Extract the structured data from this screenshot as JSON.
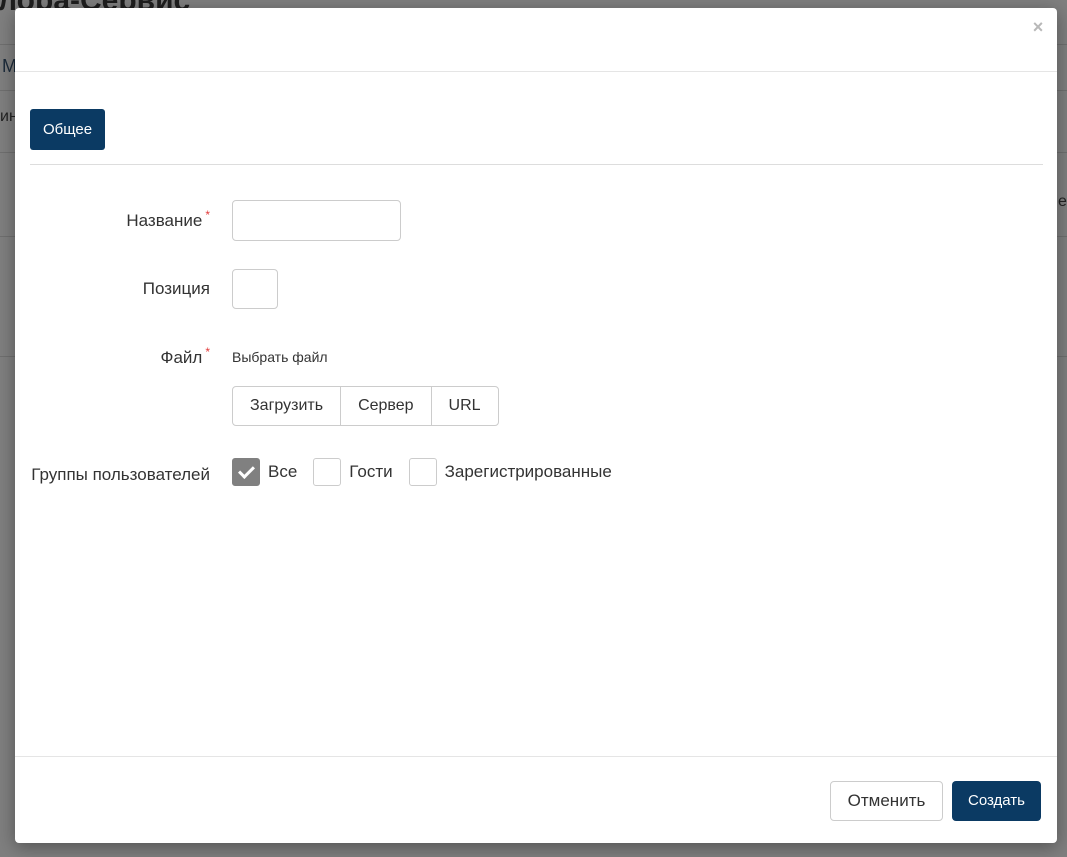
{
  "background": {
    "title": "лора-Сервис",
    "fragment_1": "М",
    "fragment_2": "ин",
    "fragment_3": "е"
  },
  "modal": {
    "close_icon": "close-icon",
    "tabs": [
      {
        "label": "Общее",
        "active": true
      }
    ],
    "form": {
      "name": {
        "label": "Название",
        "required_mark": "*",
        "value": ""
      },
      "position": {
        "label": "Позиция",
        "value": ""
      },
      "file": {
        "label": "Файл",
        "required_mark": "*",
        "title": "Выбрать файл",
        "sources": [
          "Загрузить",
          "Сервер",
          "URL"
        ]
      },
      "user_groups": {
        "label": "Группы пользователей",
        "options": [
          {
            "label": "Все",
            "checked": true
          },
          {
            "label": "Гости",
            "checked": false
          },
          {
            "label": "Зарегистрированные",
            "checked": false
          }
        ]
      }
    },
    "footer": {
      "cancel_label": "Отменить",
      "create_label": "Создать"
    }
  },
  "colors": {
    "primary": "#0b3a63",
    "required": "#e23b3b",
    "overlay": "#7f7f7f"
  }
}
